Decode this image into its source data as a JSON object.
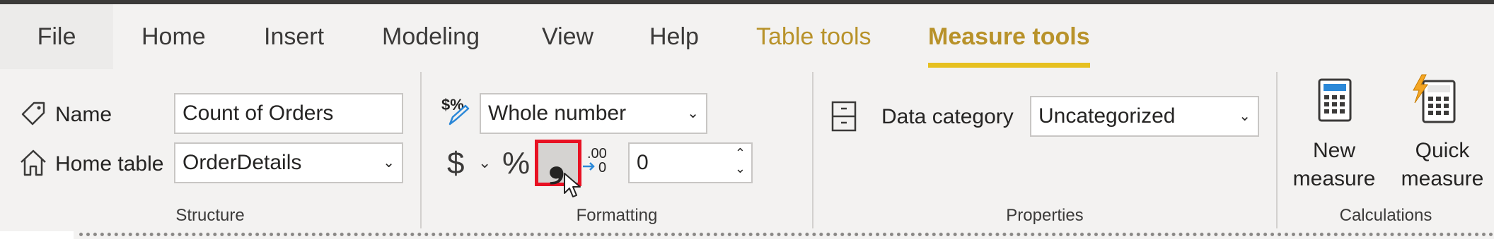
{
  "tabs": [
    {
      "label": "File"
    },
    {
      "label": "Home"
    },
    {
      "label": "Insert"
    },
    {
      "label": "Modeling"
    },
    {
      "label": "View"
    },
    {
      "label": "Help"
    },
    {
      "label": "Table tools"
    },
    {
      "label": "Measure tools"
    }
  ],
  "structure": {
    "group_label": "Structure",
    "name_label": "Name",
    "name_value": "Count of Orders",
    "home_table_label": "Home table",
    "home_table_value": "OrderDetails"
  },
  "formatting": {
    "group_label": "Formatting",
    "format_value": "Whole number",
    "currency_symbol": "$",
    "percent_symbol": "%",
    "comma_symbol": "❟",
    "decimal_places_value": "0",
    "decimal_top": ".00",
    "decimal_bottom": "0"
  },
  "properties": {
    "group_label": "Properties",
    "data_category_label": "Data category",
    "data_category_value": "Uncategorized"
  },
  "calculations": {
    "group_label": "Calculations",
    "new_measure_line1": "New",
    "new_measure_line2": "measure",
    "quick_measure_line1": "Quick",
    "quick_measure_line2": "measure"
  },
  "colors": {
    "contextual_tab": "#b8922a",
    "active_underline": "#e6c020",
    "highlight_border": "#e81123",
    "accent_blue": "#2b88d8"
  },
  "icons": [
    "tag-icon",
    "home-icon",
    "format-pen-icon",
    "currency-icon",
    "percent-icon",
    "comma-icon",
    "decimal-icon",
    "data-category-icon",
    "calculator-icon",
    "quick-calculator-icon",
    "cursor-icon"
  ]
}
